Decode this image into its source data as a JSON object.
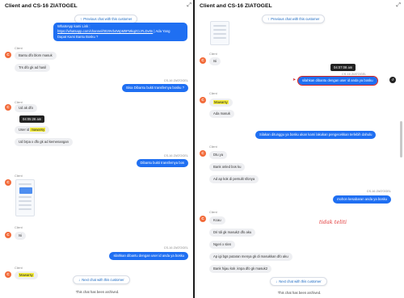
{
  "left": {
    "title": "Client and CS-16 ZIATOGEL",
    "prev_chip": "Previous chat with this customer",
    "next_chip": "Next chat with this customer",
    "archived": "This chat has been archived.",
    "top_bubble_line1": "WhatsApp kami Link :",
    "top_bubble_link": "https://whatsapp.com/channel/0029Vb4WpM9FMkqZCcFLDv0n",
    "top_bubble_line2": "| Ada Yang",
    "top_bubble_line3": "Dapat Kami Bantu Bosku ?",
    "client_label_1": "Client",
    "msg_1a": "Bantu dfo blom masuk",
    "msg_1b": "Trs dfo gk ad hasil",
    "agent_label_1": "CS-16 ZIATOGEL",
    "out_1": "Bisa Dibantu bukti transfernya bosku ?",
    "client_label_2": "Client",
    "msg_2a": "Ud ak dfo",
    "tooltip": "04:05:26 am",
    "msg_2b_pre": "User id",
    "msg_2b_hl": "mawarsy",
    "msg_2c": "Ud brpa x dfo gk ad kemenangan",
    "agent_label_2": "CS-16 ZIATOGEL",
    "out_2": "Dibantu bukti transfernya bos",
    "client_label_3": "Client",
    "client_label_4": "Client",
    "msg_4": "Isi",
    "agent_label_3": "CS-16 ZIATOGEL",
    "out_3": "silahkan dibantu dengan user id anda ya bosku",
    "client_label_5": "Client",
    "msg_5_hl": "Mawarsy"
  },
  "right": {
    "title": "Client and CS-16 ZIATOGEL",
    "prev_chip": "Previous chat with this customer",
    "next_chip": "Next chat with this customer",
    "archived": "This chat has been archived.",
    "client_label_1": "Client",
    "msg_1": "Isi",
    "tooltip": "04:07:08 am",
    "agent_label_1": "CS-16 ZIATOGEL",
    "out_1": "silahkan dibantu dengan user id anda ya bosku",
    "client_label_2": "Client",
    "msg_2a_hl": "Mawarsy",
    "msg_2b": "Ada masuk",
    "out_2": "Silakan ditunggu ya bosku akan kami lakukan pengecekkan terlebih dahulu",
    "client_label_3": "Client",
    "msg_3a": "Dtu ya",
    "msg_3b": "Bank onled bos ku",
    "msg_3c": "Ad ap kok di persulit sfonya",
    "agent_label_2": "CS-16 ZIATOGEL",
    "out_3": "mohon kesabaran anda ya bosku",
    "client_label_4": "Client",
    "msg_4a": "Kcau",
    "msg_4b": "Dri tdi gk masuk2 dfo aku",
    "msg_4c": "Ngeri x slen",
    "msg_4d": "Ap igi bgs putaran menya gk di masukkan dfo aku",
    "msg_4e": "Bank hijau kok .knpa dfo gk masuk2",
    "annotation": "tidak teliti"
  }
}
